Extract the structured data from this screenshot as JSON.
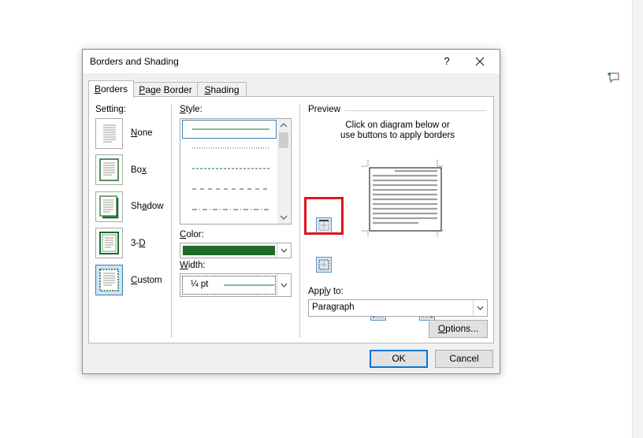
{
  "dialog": {
    "title": "Borders and Shading",
    "help": "?",
    "tabs": [
      {
        "pre": "",
        "key": "B",
        "post": "orders",
        "active": true
      },
      {
        "pre": "",
        "key": "P",
        "post": "age Border",
        "active": false
      },
      {
        "pre": "",
        "key": "S",
        "post": "hading",
        "active": false
      }
    ],
    "setting": {
      "label": "Setting:",
      "options": [
        {
          "pre": "",
          "key": "N",
          "post": "one"
        },
        {
          "pre": "Bo",
          "key": "x",
          "post": ""
        },
        {
          "pre": "Sh",
          "key": "a",
          "post": "dow"
        },
        {
          "pre": "3-",
          "key": "D",
          "post": ""
        },
        {
          "pre": "",
          "key": "C",
          "post": "ustom"
        }
      ]
    },
    "style": {
      "pre": "",
      "key": "S",
      "post": "tyle:"
    },
    "color": {
      "pre": "",
      "key": "C",
      "post": "olor:",
      "value_color": "#1e6b2a"
    },
    "width": {
      "pre": "",
      "key": "W",
      "post": "idth:",
      "value": "¼ pt"
    },
    "preview": {
      "label": "Preview",
      "instructions_line1": "Click on diagram below or",
      "instructions_line2": "use buttons to apply borders"
    },
    "apply_to": {
      "pre": "App",
      "key": "l",
      "post": "y to:",
      "value": "Paragraph"
    },
    "options_button": {
      "pre": "",
      "key": "O",
      "post": "ptions..."
    },
    "ok_label": "OK",
    "cancel_label": "Cancel",
    "accent_color": "#0078d7",
    "highlight_color": "#e0141e"
  }
}
